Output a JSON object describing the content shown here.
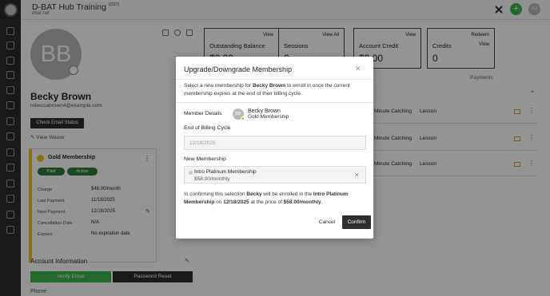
{
  "app": {
    "title": "D-BAT Hub Training",
    "title_suffix": "(CST)",
    "subtitle": "dbat.net",
    "user_initials": "AJ",
    "add_label": "+"
  },
  "profile": {
    "initials": "BB",
    "name": "Becky Brown",
    "email": "rebeccabrown4@example.com",
    "check_email_label": "Check Email Status",
    "view_waiver_label": "View Waiver"
  },
  "stats": [
    {
      "label": "Outstanding Balance",
      "value": "$0.00",
      "link": "View"
    },
    {
      "label": "Sessions",
      "value": "0",
      "link": "View All"
    },
    {
      "label": "Account Credit",
      "value": "$0.00",
      "link": "View"
    },
    {
      "label": "Credits",
      "value": "0",
      "link": "Redeem",
      "link2": "View"
    }
  ],
  "membership": {
    "title": "Gold Membership",
    "status_paid": "Paid",
    "status_active": "Active",
    "rows": [
      {
        "label": "Charge",
        "value": "$48.00/month"
      },
      {
        "label": "Last Payment",
        "value": "11/18/2025"
      },
      {
        "label": "Next Payment",
        "value": "12/18/2025"
      },
      {
        "label": "Cancellation Date",
        "value": "N/A"
      },
      {
        "label": "Expires",
        "value": "No expiration date"
      }
    ]
  },
  "account": {
    "section_title": "Account Information",
    "verify_label": "Verify Email",
    "reset_label": "Password Reset",
    "phone_label": "Phone"
  },
  "tabs": {
    "left_partial": "s",
    "payments": "Payments"
  },
  "lessons": [
    {
      "name": "Minute Catching",
      "type": "Lesson"
    },
    {
      "name": "Minute Catching",
      "type": "Lesson"
    },
    {
      "name": "Minute Catching",
      "type": "Lesson"
    }
  ],
  "modal": {
    "title": "Upgrade/Downgrade Membership",
    "desc_1": "Select a new membership for ",
    "desc_name": "Becky Brown",
    "desc_2": " to enroll in once the current membership expires at the end of their billing cycle.",
    "member_details_label": "Member Details",
    "member_initials": "BB",
    "member_name": "Becky Brown",
    "member_membership": "Gold Membership",
    "billing_label": "End of Billing Cycle",
    "billing_date": "12/18/2025",
    "new_membership_label": "New Membership",
    "new_membership_name": "Intro Platinum Membership",
    "new_membership_price": "$58.00/monthly",
    "summary_1": "In confirming this selection ",
    "summary_name": "Becky",
    "summary_2": " will be enrolled in the ",
    "summary_membership": "Intro Platinum Membership",
    "summary_3": " on ",
    "summary_date": "12/18/2025",
    "summary_4": " at the price of ",
    "summary_price": "$58.00/monthly",
    "summary_5": ".",
    "cancel_label": "Cancel",
    "confirm_label": "Confirm"
  },
  "icons": {
    "close": "✕",
    "clear": "✕",
    "kebab": "⋮",
    "chevron": "⌃",
    "edit": "✎"
  },
  "colors": {
    "accent_green": "#3cb54a",
    "dark": "#2e2e2e",
    "gold": "#e9c01f"
  }
}
